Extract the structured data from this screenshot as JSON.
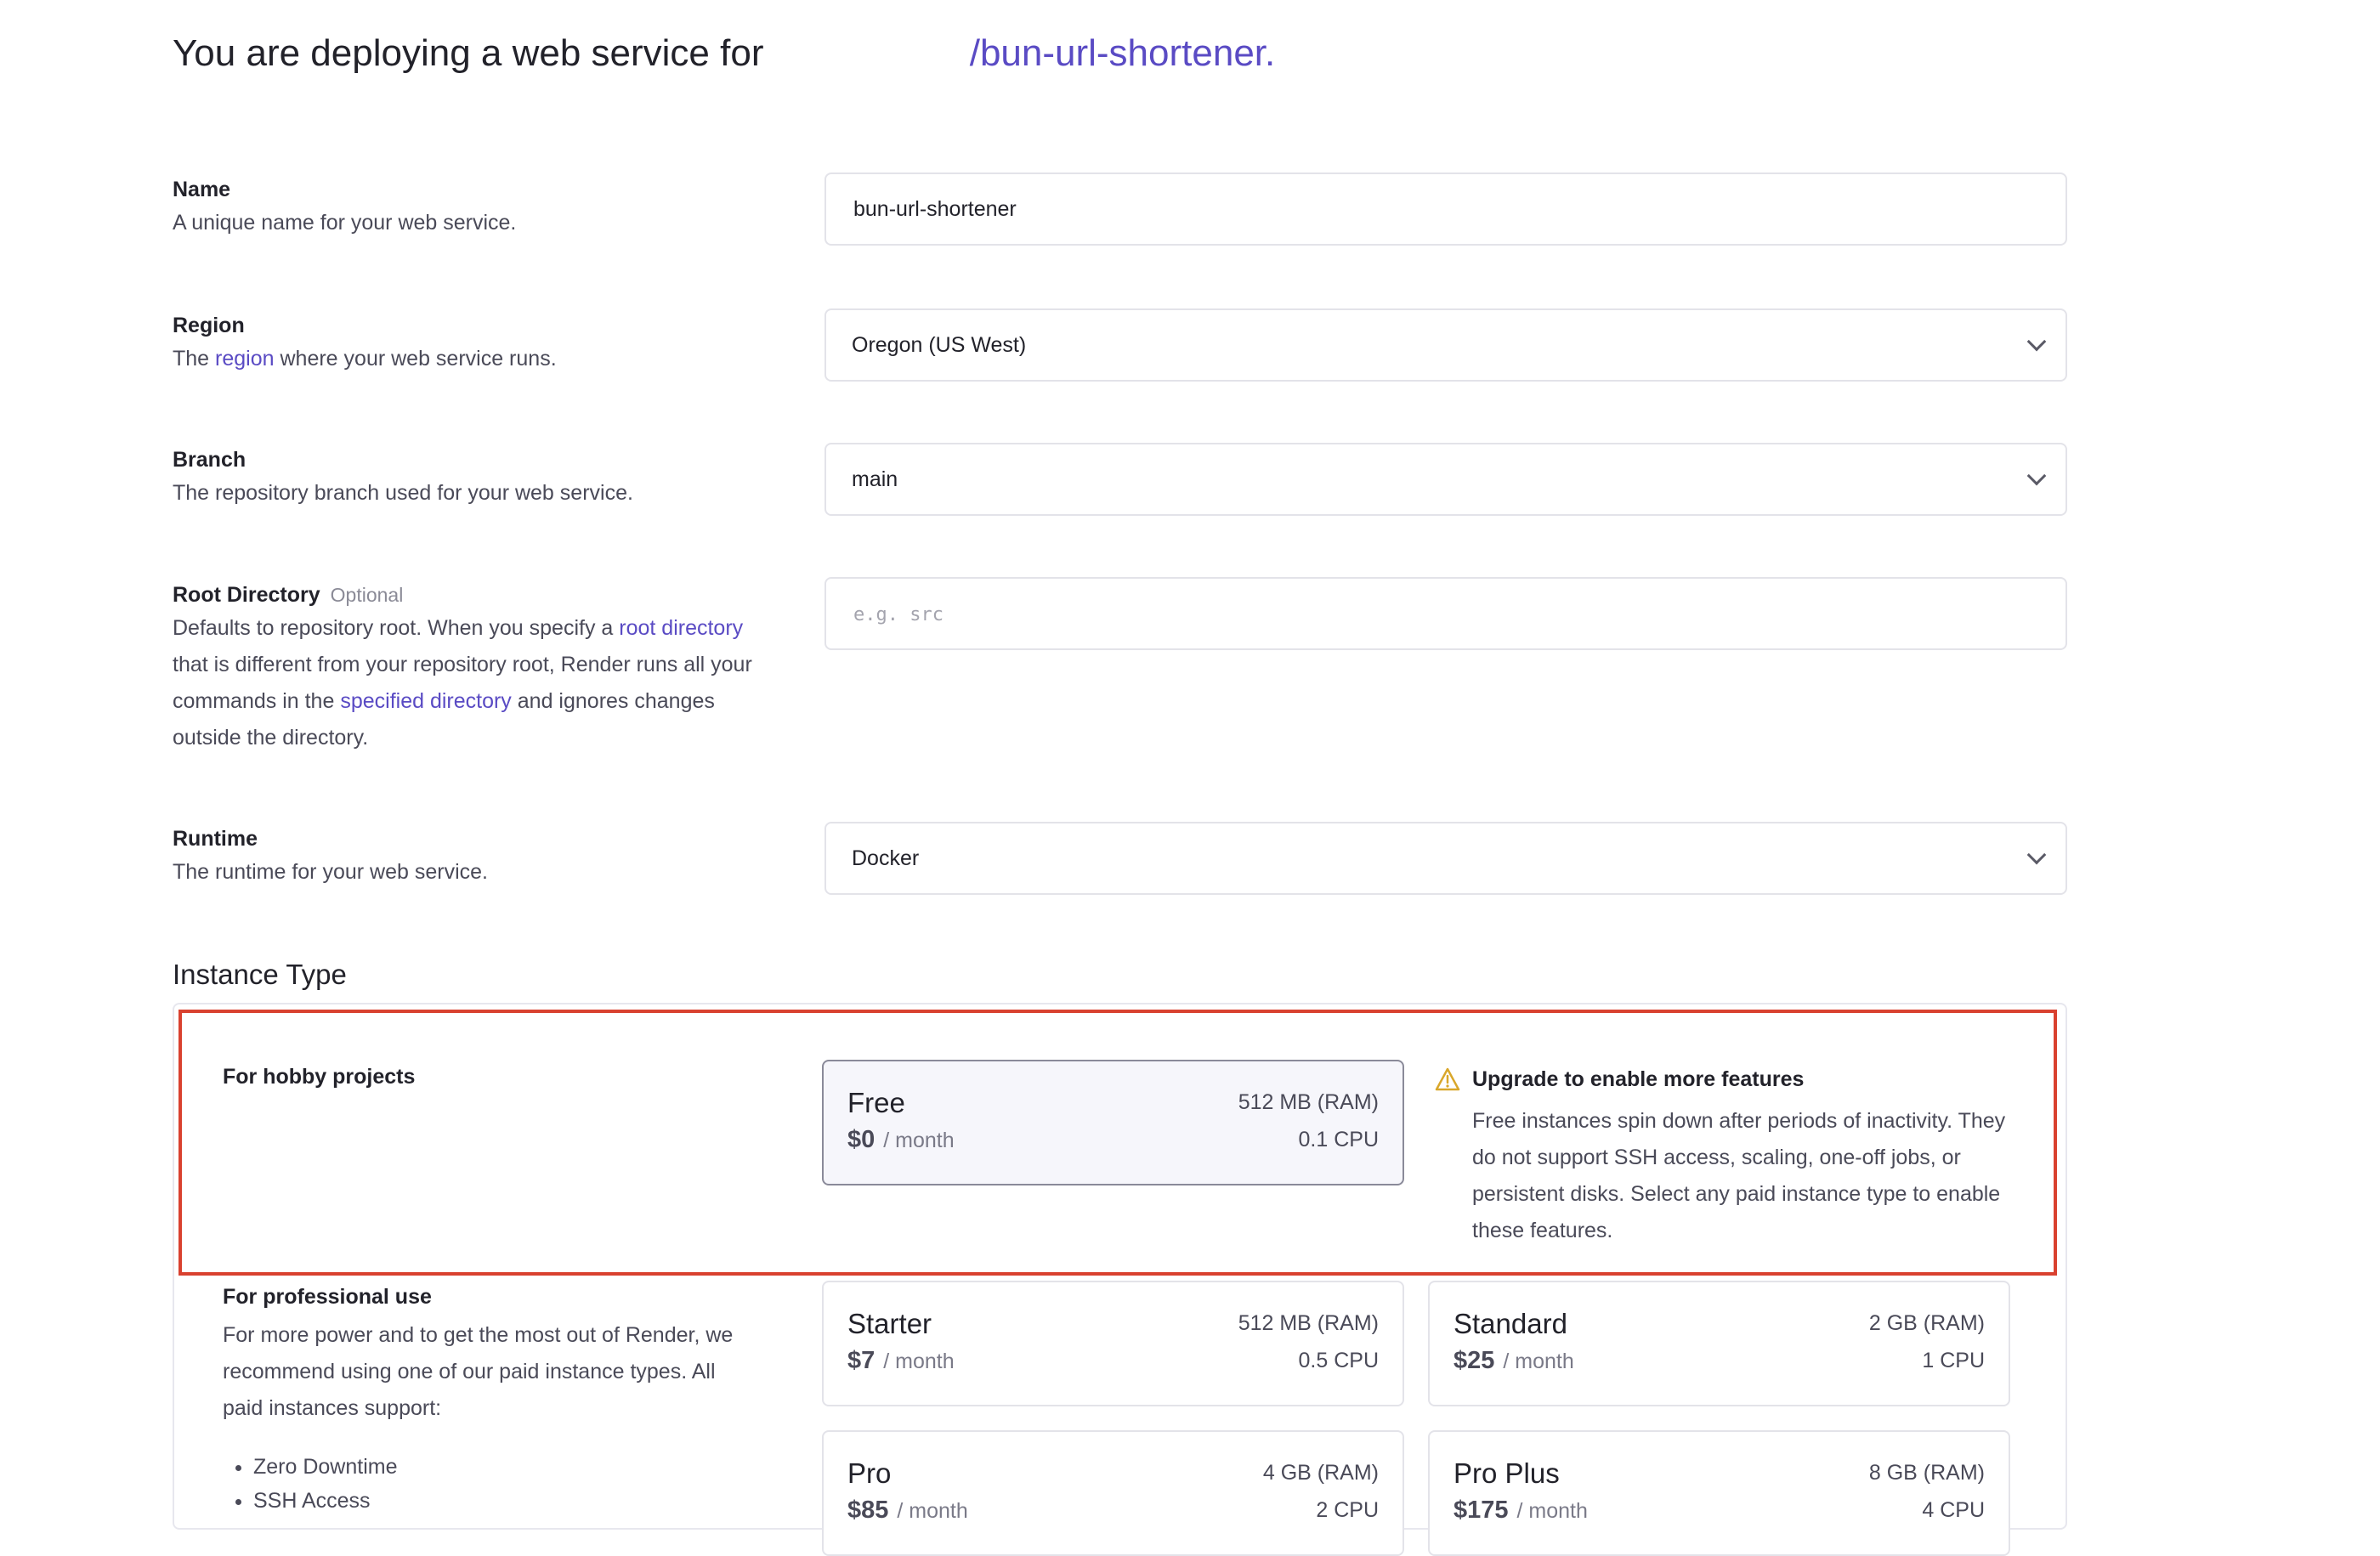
{
  "header": {
    "title_prefix": "You are deploying a web service for",
    "repo_path": "/bun-url-shortener."
  },
  "fields": {
    "name": {
      "label": "Name",
      "description": "A unique name for your web service.",
      "value": "bun-url-shortener"
    },
    "region": {
      "label": "Region",
      "desc_before": "The",
      "desc_link": "region",
      "desc_after": "where your web service runs.",
      "value": "Oregon (US West)"
    },
    "branch": {
      "label": "Branch",
      "description": "The repository branch used for your web service.",
      "value": "main"
    },
    "root_directory": {
      "label": "Root Directory",
      "optional": "Optional",
      "desc_1": "Defaults to repository root. When you specify a",
      "desc_link_1": "root directory",
      "desc_2": "that is different from your repository root, Render runs all your commands in the",
      "desc_link_2": "specified directory",
      "desc_3": "and ignores changes outside the directory.",
      "placeholder": "e.g. src"
    },
    "runtime": {
      "label": "Runtime",
      "description": "The runtime for your web service.",
      "value": "Docker"
    }
  },
  "instance_type": {
    "title": "Instance Type",
    "hobby": {
      "label": "For hobby projects",
      "plans": [
        {
          "name": "Free",
          "price": "$0",
          "per": "/ month",
          "ram": "512 MB (RAM)",
          "cpu": "0.1 CPU"
        }
      ],
      "upgrade_title": "Upgrade to enable more features",
      "upgrade_body": "Free instances spin down after periods of inactivity. They do not support SSH access, scaling, one-off jobs, or persistent disks. Select any paid instance type to enable these features."
    },
    "professional": {
      "label": "For professional use",
      "description": "For more power and to get the most out of Render, we recommend using one of our paid instance types. All paid instances support:",
      "bullets": [
        "Zero Downtime",
        "SSH Access"
      ],
      "plans": [
        {
          "name": "Starter",
          "price": "$7",
          "per": "/ month",
          "ram": "512 MB (RAM)",
          "cpu": "0.5 CPU"
        },
        {
          "name": "Standard",
          "price": "$25",
          "per": "/ month",
          "ram": "2 GB (RAM)",
          "cpu": "1 CPU"
        },
        {
          "name": "Pro",
          "price": "$85",
          "per": "/ month",
          "ram": "4 GB (RAM)",
          "cpu": "2 CPU"
        },
        {
          "name": "Pro Plus",
          "price": "$175",
          "per": "/ month",
          "ram": "8 GB (RAM)",
          "cpu": "4 CPU"
        }
      ]
    }
  },
  "colors": {
    "accent": "#5a4bc4",
    "highlight": "#d9412f",
    "warning": "#d9a72a"
  },
  "icons": {
    "select_chevron": "chevron-down-icon",
    "warning": "warning-icon"
  }
}
